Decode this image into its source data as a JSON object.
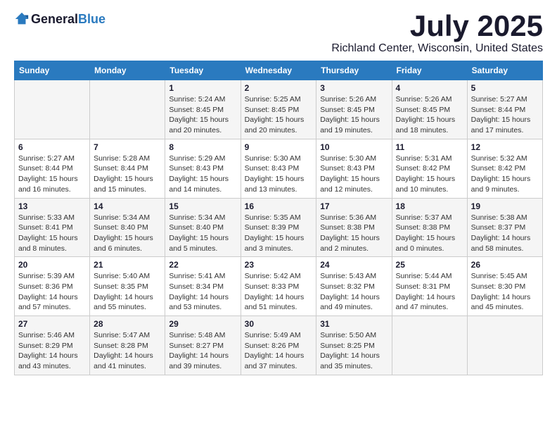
{
  "logo": {
    "general": "General",
    "blue": "Blue"
  },
  "title": "July 2025",
  "location": "Richland Center, Wisconsin, United States",
  "days_of_week": [
    "Sunday",
    "Monday",
    "Tuesday",
    "Wednesday",
    "Thursday",
    "Friday",
    "Saturday"
  ],
  "weeks": [
    [
      {
        "day": "",
        "info": ""
      },
      {
        "day": "",
        "info": ""
      },
      {
        "day": "1",
        "info": "Sunrise: 5:24 AM\nSunset: 8:45 PM\nDaylight: 15 hours and 20 minutes."
      },
      {
        "day": "2",
        "info": "Sunrise: 5:25 AM\nSunset: 8:45 PM\nDaylight: 15 hours and 20 minutes."
      },
      {
        "day": "3",
        "info": "Sunrise: 5:26 AM\nSunset: 8:45 PM\nDaylight: 15 hours and 19 minutes."
      },
      {
        "day": "4",
        "info": "Sunrise: 5:26 AM\nSunset: 8:45 PM\nDaylight: 15 hours and 18 minutes."
      },
      {
        "day": "5",
        "info": "Sunrise: 5:27 AM\nSunset: 8:44 PM\nDaylight: 15 hours and 17 minutes."
      }
    ],
    [
      {
        "day": "6",
        "info": "Sunrise: 5:27 AM\nSunset: 8:44 PM\nDaylight: 15 hours and 16 minutes."
      },
      {
        "day": "7",
        "info": "Sunrise: 5:28 AM\nSunset: 8:44 PM\nDaylight: 15 hours and 15 minutes."
      },
      {
        "day": "8",
        "info": "Sunrise: 5:29 AM\nSunset: 8:43 PM\nDaylight: 15 hours and 14 minutes."
      },
      {
        "day": "9",
        "info": "Sunrise: 5:30 AM\nSunset: 8:43 PM\nDaylight: 15 hours and 13 minutes."
      },
      {
        "day": "10",
        "info": "Sunrise: 5:30 AM\nSunset: 8:43 PM\nDaylight: 15 hours and 12 minutes."
      },
      {
        "day": "11",
        "info": "Sunrise: 5:31 AM\nSunset: 8:42 PM\nDaylight: 15 hours and 10 minutes."
      },
      {
        "day": "12",
        "info": "Sunrise: 5:32 AM\nSunset: 8:42 PM\nDaylight: 15 hours and 9 minutes."
      }
    ],
    [
      {
        "day": "13",
        "info": "Sunrise: 5:33 AM\nSunset: 8:41 PM\nDaylight: 15 hours and 8 minutes."
      },
      {
        "day": "14",
        "info": "Sunrise: 5:34 AM\nSunset: 8:40 PM\nDaylight: 15 hours and 6 minutes."
      },
      {
        "day": "15",
        "info": "Sunrise: 5:34 AM\nSunset: 8:40 PM\nDaylight: 15 hours and 5 minutes."
      },
      {
        "day": "16",
        "info": "Sunrise: 5:35 AM\nSunset: 8:39 PM\nDaylight: 15 hours and 3 minutes."
      },
      {
        "day": "17",
        "info": "Sunrise: 5:36 AM\nSunset: 8:38 PM\nDaylight: 15 hours and 2 minutes."
      },
      {
        "day": "18",
        "info": "Sunrise: 5:37 AM\nSunset: 8:38 PM\nDaylight: 15 hours and 0 minutes."
      },
      {
        "day": "19",
        "info": "Sunrise: 5:38 AM\nSunset: 8:37 PM\nDaylight: 14 hours and 58 minutes."
      }
    ],
    [
      {
        "day": "20",
        "info": "Sunrise: 5:39 AM\nSunset: 8:36 PM\nDaylight: 14 hours and 57 minutes."
      },
      {
        "day": "21",
        "info": "Sunrise: 5:40 AM\nSunset: 8:35 PM\nDaylight: 14 hours and 55 minutes."
      },
      {
        "day": "22",
        "info": "Sunrise: 5:41 AM\nSunset: 8:34 PM\nDaylight: 14 hours and 53 minutes."
      },
      {
        "day": "23",
        "info": "Sunrise: 5:42 AM\nSunset: 8:33 PM\nDaylight: 14 hours and 51 minutes."
      },
      {
        "day": "24",
        "info": "Sunrise: 5:43 AM\nSunset: 8:32 PM\nDaylight: 14 hours and 49 minutes."
      },
      {
        "day": "25",
        "info": "Sunrise: 5:44 AM\nSunset: 8:31 PM\nDaylight: 14 hours and 47 minutes."
      },
      {
        "day": "26",
        "info": "Sunrise: 5:45 AM\nSunset: 8:30 PM\nDaylight: 14 hours and 45 minutes."
      }
    ],
    [
      {
        "day": "27",
        "info": "Sunrise: 5:46 AM\nSunset: 8:29 PM\nDaylight: 14 hours and 43 minutes."
      },
      {
        "day": "28",
        "info": "Sunrise: 5:47 AM\nSunset: 8:28 PM\nDaylight: 14 hours and 41 minutes."
      },
      {
        "day": "29",
        "info": "Sunrise: 5:48 AM\nSunset: 8:27 PM\nDaylight: 14 hours and 39 minutes."
      },
      {
        "day": "30",
        "info": "Sunrise: 5:49 AM\nSunset: 8:26 PM\nDaylight: 14 hours and 37 minutes."
      },
      {
        "day": "31",
        "info": "Sunrise: 5:50 AM\nSunset: 8:25 PM\nDaylight: 14 hours and 35 minutes."
      },
      {
        "day": "",
        "info": ""
      },
      {
        "day": "",
        "info": ""
      }
    ]
  ]
}
